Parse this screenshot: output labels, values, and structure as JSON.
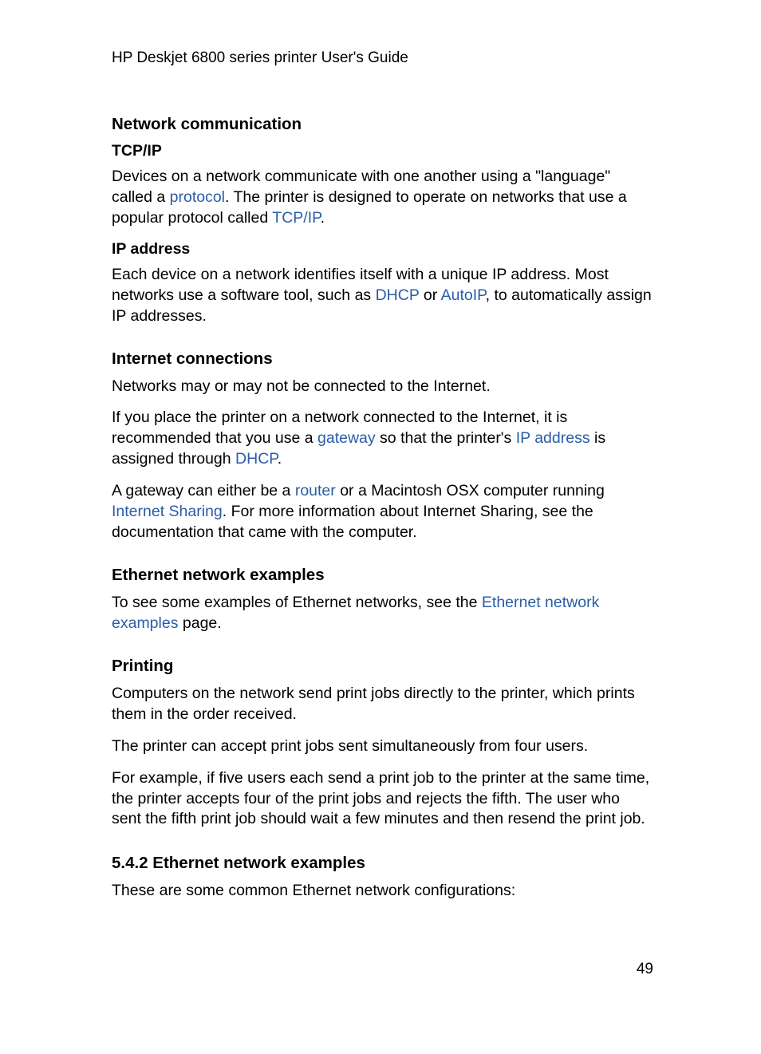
{
  "header": {
    "title": "HP Deskjet 6800 series printer User's Guide"
  },
  "sections": {
    "network_comm": {
      "heading": "Network communication",
      "tcpip": {
        "heading": "TCP/IP",
        "para_parts": {
          "t1": "Devices on a network communicate with one another using a \"language\" called a ",
          "link_protocol": "protocol",
          "t2": ". The printer is designed to operate on networks that use a popular protocol called ",
          "link_tcpip": "TCP/IP",
          "t3": "."
        }
      },
      "ip_address": {
        "heading": "IP address",
        "para_parts": {
          "t1": "Each device on a network identifies itself with a unique IP address. Most networks use a software tool, such as ",
          "link_dhcp": "DHCP",
          "t2": " or ",
          "link_autoip": "AutoIP",
          "t3": ", to automatically assign IP addresses."
        }
      }
    },
    "internet_conn": {
      "heading": "Internet connections",
      "p1": "Networks may or may not be connected to the Internet.",
      "p2_parts": {
        "t1": "If you place the printer on a network connected to the Internet, it is recommended that you use a ",
        "link_gateway": "gateway",
        "t2": " so that the printer's ",
        "link_ip": "IP address",
        "t3": " is assigned through ",
        "link_dhcp": "DHCP",
        "t4": "."
      },
      "p3_parts": {
        "t1": "A gateway can either be a ",
        "link_router": "router",
        "t2": " or a Macintosh OSX computer running ",
        "link_sharing": "Internet Sharing",
        "t3": ". For more information about Internet Sharing, see the documentation that came with the computer."
      }
    },
    "ethernet_examples": {
      "heading": "Ethernet network examples",
      "p1_parts": {
        "t1": "To see some examples of Ethernet networks, see the ",
        "link_examples": "Ethernet network examples",
        "t2": " page."
      }
    },
    "printing": {
      "heading": "Printing",
      "p1": "Computers on the network send print jobs directly to the printer, which prints them in the order received.",
      "p2": "The printer can accept print jobs sent simultaneously from four users.",
      "p3": "For example, if five users each send a print job to the printer at the same time, the printer accepts four of the print jobs and rejects the fifth. The user who sent the fifth print job should wait a few minutes and then resend the print job."
    },
    "section_542": {
      "heading": "5.4.2  Ethernet network examples",
      "p1": "These are some common Ethernet network configurations:"
    }
  },
  "page_number": "49"
}
